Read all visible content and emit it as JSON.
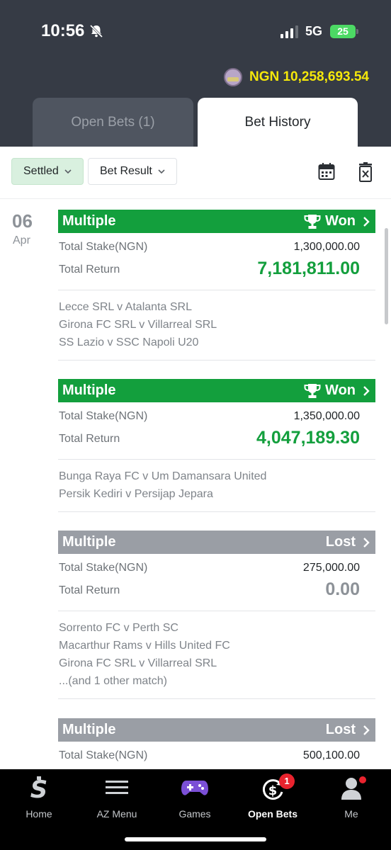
{
  "status_bar": {
    "time": "10:56",
    "network": "5G",
    "battery": "25"
  },
  "balance": {
    "text": "NGN 10,258,693.54"
  },
  "tabs": [
    {
      "label": "Open Bets (1)"
    },
    {
      "label": "Bet History"
    }
  ],
  "filters": {
    "settled": "Settled",
    "bet_result": "Bet Result"
  },
  "date": {
    "day": "06",
    "month": "Apr"
  },
  "bets": [
    {
      "type": "Multiple",
      "status": "Won",
      "stake_label": "Total Stake(NGN)",
      "stake": "1,300,000.00",
      "return_label": "Total Return",
      "return": "7,181,811.00",
      "matches": [
        "Lecce SRL v Atalanta SRL",
        "Girona FC SRL v Villarreal SRL",
        "SS Lazio v SSC Napoli U20"
      ]
    },
    {
      "type": "Multiple",
      "status": "Won",
      "stake_label": "Total Stake(NGN)",
      "stake": "1,350,000.00",
      "return_label": "Total Return",
      "return": "4,047,189.30",
      "matches": [
        "Bunga Raya FC v Um Damansara United",
        "Persik Kediri v Persijap Jepara"
      ]
    },
    {
      "type": "Multiple",
      "status": "Lost",
      "stake_label": "Total Stake(NGN)",
      "stake": "275,000.00",
      "return_label": "Total Return",
      "return": "0.00",
      "matches": [
        "Sorrento FC v Perth SC",
        "Macarthur Rams v Hills United FC",
        "Girona FC SRL v Villarreal SRL",
        "...(and 1 other match)"
      ]
    },
    {
      "type": "Multiple",
      "status": "Lost",
      "stake_label": "Total Stake(NGN)",
      "stake": "500,100.00"
    }
  ],
  "nav": [
    {
      "label": "Home",
      "icon": "home-logo-icon"
    },
    {
      "label": "AZ Menu",
      "icon": "menu-icon"
    },
    {
      "label": "Games",
      "icon": "gamepad-icon"
    },
    {
      "label": "Open Bets",
      "icon": "open-bets-icon",
      "badge": "1"
    },
    {
      "label": "Me",
      "icon": "user-icon"
    }
  ],
  "colors": {
    "won": "#139f3d",
    "lost": "#9a9ea5",
    "header": "#363b45",
    "balance": "#f5e80a"
  }
}
